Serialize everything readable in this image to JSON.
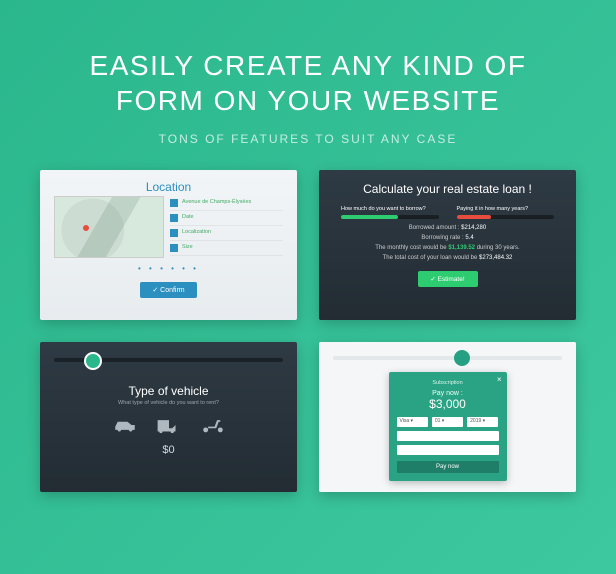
{
  "hero": {
    "title_l1": "EASILY CREATE ANY KIND OF",
    "title_l2": "FORM ON YOUR WEBSITE",
    "subtitle": "TONS OF FEATURES TO SUIT ANY CASE"
  },
  "card1": {
    "title": "Location",
    "list": [
      "Avenue de Champs-Élysées",
      "Date",
      "Localization",
      "Size"
    ],
    "dots": "• • • • • •",
    "button": "✓ Confirm"
  },
  "card2": {
    "title": "Calculate your real estate loan !",
    "q1": "How much do you want to borrow?",
    "q2": "Paying it in how many years?",
    "l1_label": "Borrowed amount :",
    "l1_val": "$214,280",
    "l2_label": "Borrowing rate :",
    "l2_val": "5.4",
    "l3_pre": "The monthly cost would be",
    "l3_val": "$1,139.52",
    "l3_post": "during 30 years.",
    "l4_pre": "The total cost of your loan would be",
    "l4_val": "$273,484.32",
    "button": "✓ Estimate!"
  },
  "card3": {
    "title": "Type of vehicle",
    "sub": "What type of vehicle do you want to rent?",
    "price": "$0"
  },
  "card4": {
    "head": "Subscription",
    "paynow": "Pay now :",
    "amount": "$3,000",
    "sel1": "Visa ▾",
    "sel2": "01 ▾",
    "sel3": "2019 ▾",
    "button": "Pay now"
  }
}
